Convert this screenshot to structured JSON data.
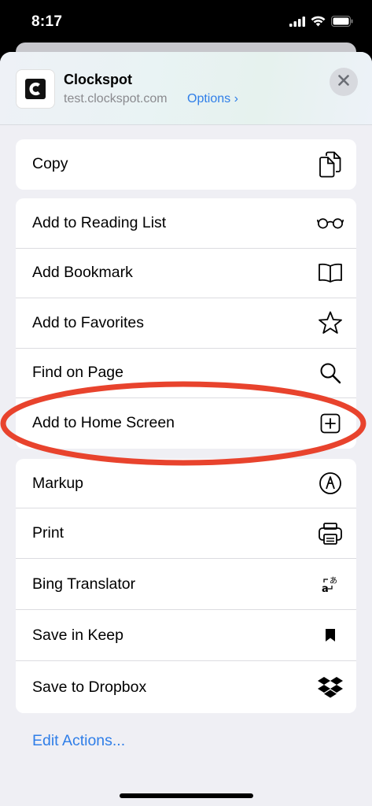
{
  "status": {
    "time": "8:17"
  },
  "header": {
    "app_name": "Clockspot",
    "url": "test.clockspot.com",
    "options_label": "Options ›"
  },
  "groups": [
    {
      "items": [
        {
          "label": "Copy",
          "icon": "copy-icon"
        }
      ]
    },
    {
      "items": [
        {
          "label": "Add to Reading List",
          "icon": "glasses-icon"
        },
        {
          "label": "Add Bookmark",
          "icon": "book-icon"
        },
        {
          "label": "Add to Favorites",
          "icon": "star-icon"
        },
        {
          "label": "Find on Page",
          "icon": "search-icon"
        },
        {
          "label": "Add to Home Screen",
          "icon": "plus-square-icon"
        }
      ]
    },
    {
      "items": [
        {
          "label": "Markup",
          "icon": "markup-icon"
        },
        {
          "label": "Print",
          "icon": "printer-icon"
        },
        {
          "label": "Bing Translator",
          "icon": "translate-icon"
        },
        {
          "label": "Save in Keep",
          "icon": "bookmark-filled-icon"
        },
        {
          "label": "Save to Dropbox",
          "icon": "dropbox-icon"
        }
      ]
    }
  ],
  "footer": {
    "edit_actions": "Edit Actions..."
  },
  "colors": {
    "accent": "#2f7ee8",
    "highlight": "#e8432d"
  }
}
